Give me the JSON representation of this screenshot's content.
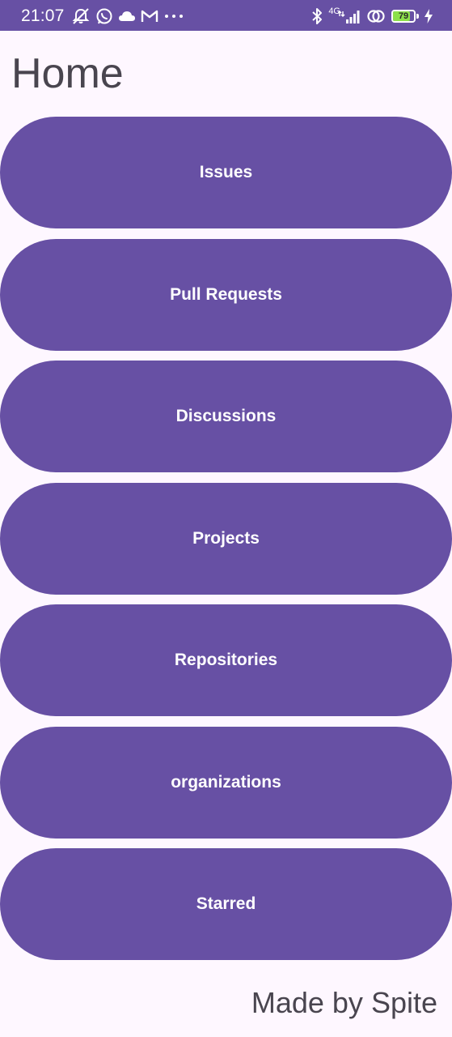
{
  "status_bar": {
    "time": "21:07",
    "left_icons": [
      "alarm-off-icon",
      "whatsapp-icon",
      "cloud-icon",
      "gmail-icon",
      "more-dots-icon"
    ],
    "more_label": "···",
    "network_type": "4G",
    "battery_level": "79",
    "battery_fraction": 0.79,
    "colors": {
      "background": "#6750A4",
      "battery_fill": "#8CE04A"
    }
  },
  "header": {
    "title": "Home"
  },
  "nav": {
    "items": [
      {
        "label": "Issues"
      },
      {
        "label": "Pull Requests"
      },
      {
        "label": "Discussions"
      },
      {
        "label": "Projects"
      },
      {
        "label": "Repositories"
      },
      {
        "label": "organizations"
      },
      {
        "label": "Starred"
      }
    ]
  },
  "footer": {
    "text": "Made by Spite"
  },
  "colors": {
    "primary": "#6750A4",
    "background": "#FEF7FF",
    "on_surface": "#49454F",
    "on_primary": "#FFFFFF"
  }
}
